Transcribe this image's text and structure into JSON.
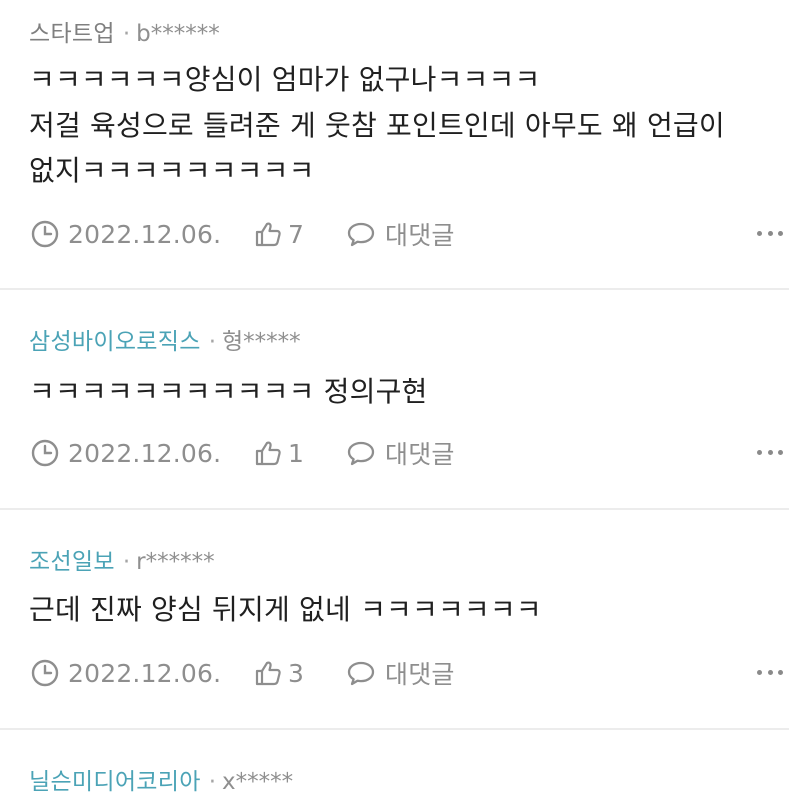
{
  "comments": [
    {
      "group": "스타트업",
      "separator": "·",
      "user": "b******",
      "lines": [
        "ㅋㅋㅋㅋㅋㅋ양심이 엄마가 없구나ㅋㅋㅋㅋ",
        "저걸 육성으로 들려준 게 웃참 포인트인데 아무도 왜 언급이",
        "없지ㅋㅋㅋㅋㅋㅋㅋㅋㅋ"
      ],
      "date": "2022.12.06.",
      "likes": "7",
      "reply_label": "대댓글"
    },
    {
      "group": "삼성바이오로직스",
      "separator": "·",
      "user": "형*****",
      "lines": [
        "ㅋㅋㅋㅋㅋㅋㅋㅋㅋㅋㅋ 정의구현"
      ],
      "date": "2022.12.06.",
      "likes": "1",
      "reply_label": "대댓글"
    },
    {
      "group": "조선일보",
      "separator": "·",
      "user": "r******",
      "lines": [
        "근데 진짜 양심 뒤지게 없네 ㅋㅋㅋㅋㅋㅋㅋ"
      ],
      "date": "2022.12.06.",
      "likes": "3",
      "reply_label": "대댓글"
    },
    {
      "group": "닐슨미디어코리아",
      "separator": "·",
      "user": "x*****"
    }
  ],
  "colors": {
    "group_plain": "#7f7f7f",
    "group_linked": "#4ba3b6",
    "text": "#202020",
    "muted": "#8e8e8e",
    "divider": "#ececec"
  },
  "icons": {
    "date": "clock-icon",
    "likes": "thumbs-up-icon",
    "reply": "speech-bubble-icon",
    "more": "more-dots-icon"
  }
}
